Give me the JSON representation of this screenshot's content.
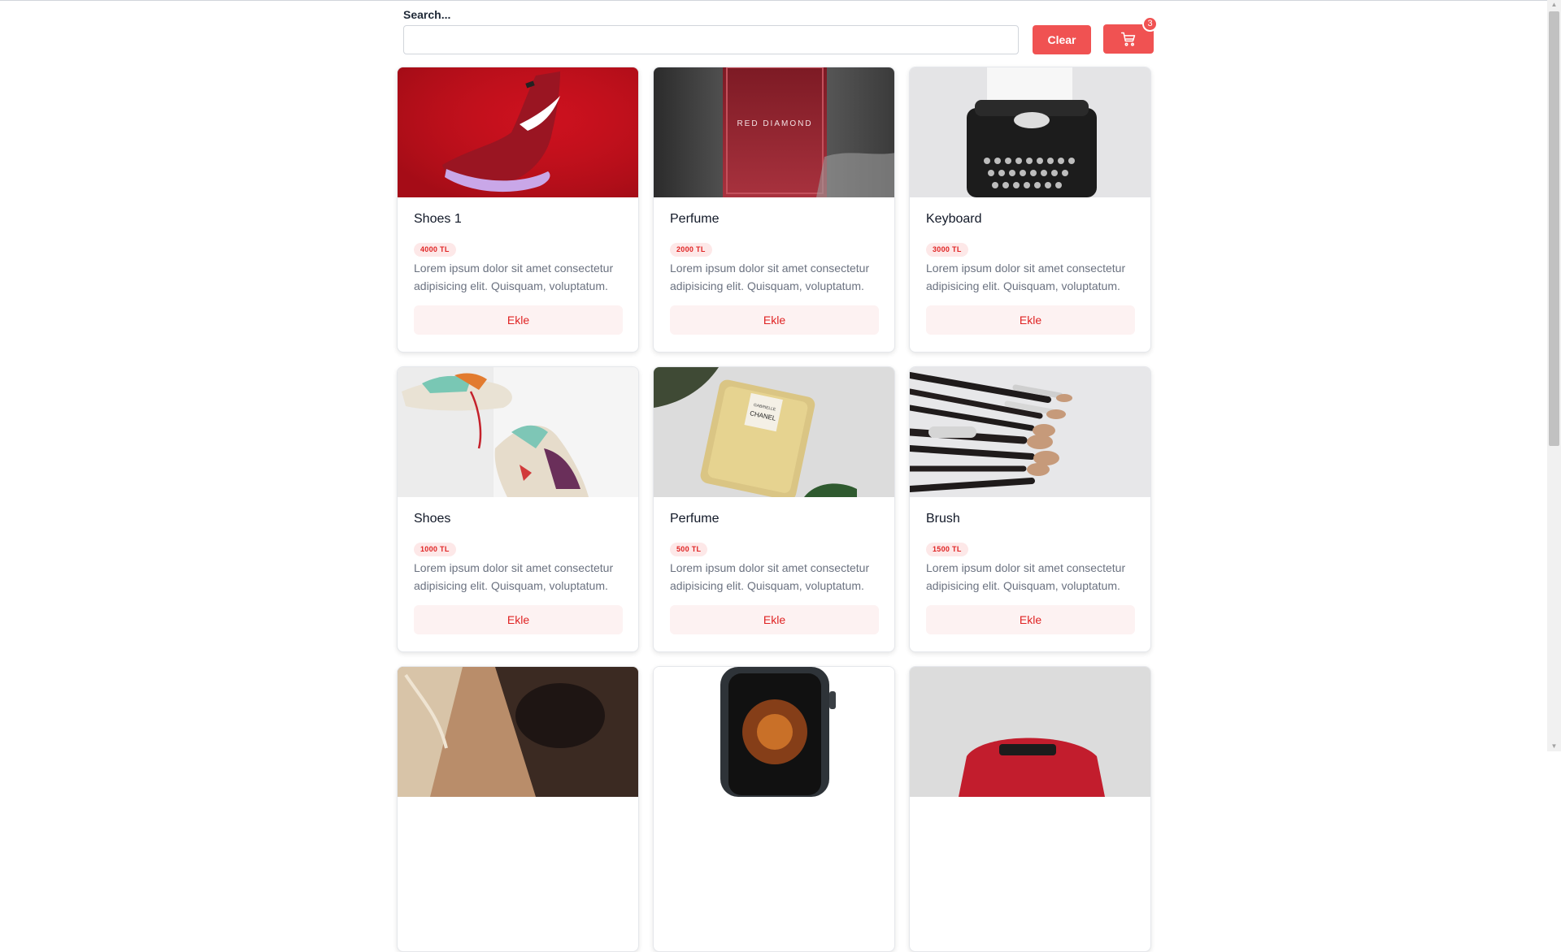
{
  "search": {
    "label": "Search...",
    "value": "",
    "placeholder": ""
  },
  "toolbar": {
    "clear_label": "Clear",
    "cart_icon": "shopping-cart-icon",
    "cart_count": "3"
  },
  "products": [
    {
      "title": "Shoes 1",
      "price": "4000 TL",
      "description": "Lorem ipsum dolor sit amet consectetur adipisicing elit. Quisquam, voluptatum.",
      "button": "Ekle",
      "image": "red-sneaker"
    },
    {
      "title": "Perfume",
      "price": "2000 TL",
      "description": "Lorem ipsum dolor sit amet consectetur adipisicing elit. Quisquam, voluptatum.",
      "button": "Ekle",
      "image": "red-perfume-bottle"
    },
    {
      "title": "Keyboard",
      "price": "3000 TL",
      "description": "Lorem ipsum dolor sit amet consectetur adipisicing elit. Quisquam, voluptatum.",
      "button": "Ekle",
      "image": "typewriter"
    },
    {
      "title": "Shoes",
      "price": "1000 TL",
      "description": "Lorem ipsum dolor sit amet consectetur adipisicing elit. Quisquam, voluptatum.",
      "button": "Ekle",
      "image": "colorful-sneakers"
    },
    {
      "title": "Perfume",
      "price": "500 TL",
      "description": "Lorem ipsum dolor sit amet consectetur adipisicing elit. Quisquam, voluptatum.",
      "button": "Ekle",
      "image": "chanel-perfume"
    },
    {
      "title": "Brush",
      "price": "1500 TL",
      "description": "Lorem ipsum dolor sit amet consectetur adipisicing elit. Quisquam, voluptatum.",
      "button": "Ekle",
      "image": "makeup-brushes"
    },
    {
      "title": "",
      "price": "",
      "description": "",
      "button": "",
      "image": "sunglasses"
    },
    {
      "title": "",
      "price": "",
      "description": "",
      "button": "",
      "image": "smartwatch"
    },
    {
      "title": "",
      "price": "",
      "description": "",
      "button": "",
      "image": "red-bag"
    }
  ],
  "product_images": {
    "red_perfume_text": "RED DIAMOND",
    "chanel_text_1": "GABRIELLE",
    "chanel_text_2": "CHANEL"
  },
  "colors": {
    "accent": "#f05252",
    "price_bg": "#fde8e8",
    "price_text": "#e02424",
    "button_bg": "#fdf2f2"
  }
}
